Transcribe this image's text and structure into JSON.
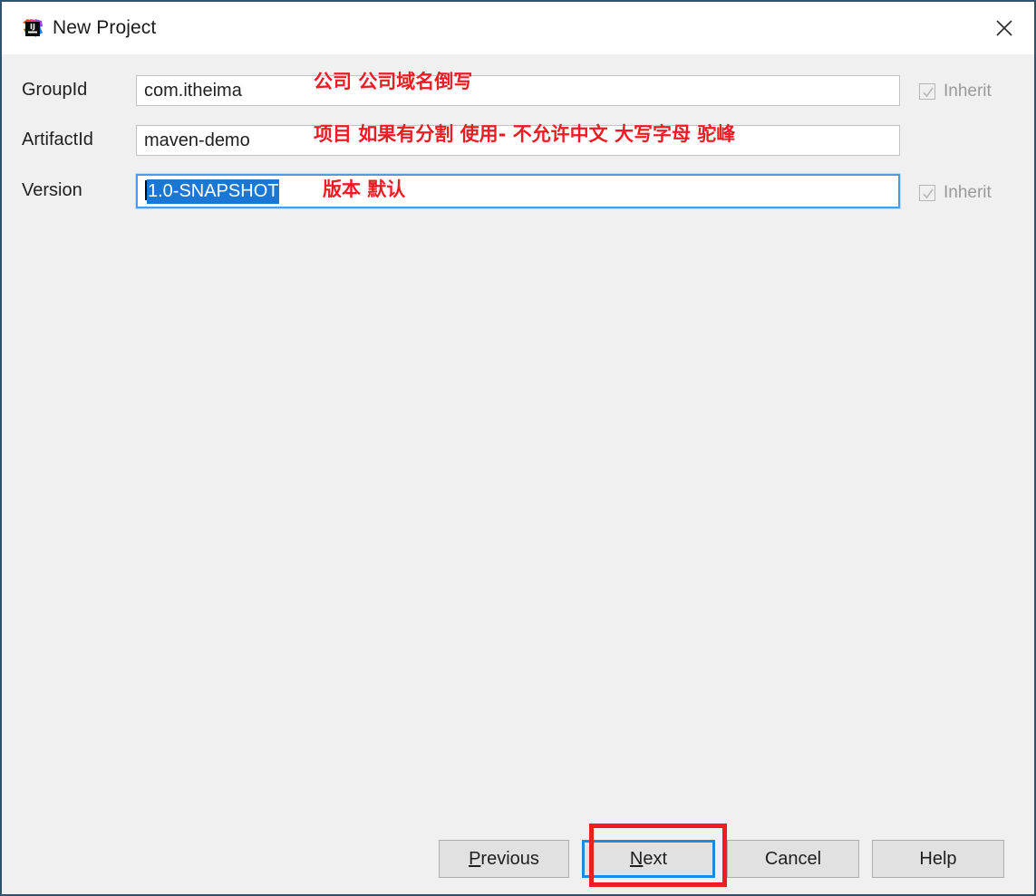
{
  "window": {
    "title": "New Project",
    "app_icon": "intellij-idea-icon",
    "close_icon": "close-icon",
    "border_color": "#31526b",
    "titlebar_bg": "#ffffff",
    "body_bg": "#f0f0f0"
  },
  "form": {
    "fields": [
      {
        "label": "GroupId",
        "value": "com.itheima",
        "focused": false,
        "selected": false,
        "inherit": {
          "label": "Inherit",
          "checked": true,
          "enabled": false
        }
      },
      {
        "label": "ArtifactId",
        "value": "maven-demo",
        "focused": false,
        "selected": false,
        "inherit": null
      },
      {
        "label": "Version",
        "value": "1.0-SNAPSHOT",
        "focused": true,
        "selected": true,
        "inherit": {
          "label": "Inherit",
          "checked": true,
          "enabled": false
        }
      }
    ]
  },
  "annotations": {
    "color": "#ed1c24",
    "groupid_note": "公司  公司域名倒写",
    "artifactid_note": "项目  如果有分割  使用-      不允许中文 大写字母  驼峰",
    "version_note": "版本    默认",
    "highlight_target": "Next"
  },
  "buttons": [
    {
      "name": "previous",
      "label_before": "",
      "mnemonic": "P",
      "label_after": "revious",
      "focused": false
    },
    {
      "name": "next",
      "label_before": "",
      "mnemonic": "N",
      "label_after": "ext",
      "focused": true
    },
    {
      "name": "cancel",
      "label_before": "Cancel",
      "mnemonic": "",
      "label_after": "",
      "focused": false
    },
    {
      "name": "help",
      "label_before": "Help",
      "mnemonic": "",
      "label_after": "",
      "focused": false
    }
  ]
}
